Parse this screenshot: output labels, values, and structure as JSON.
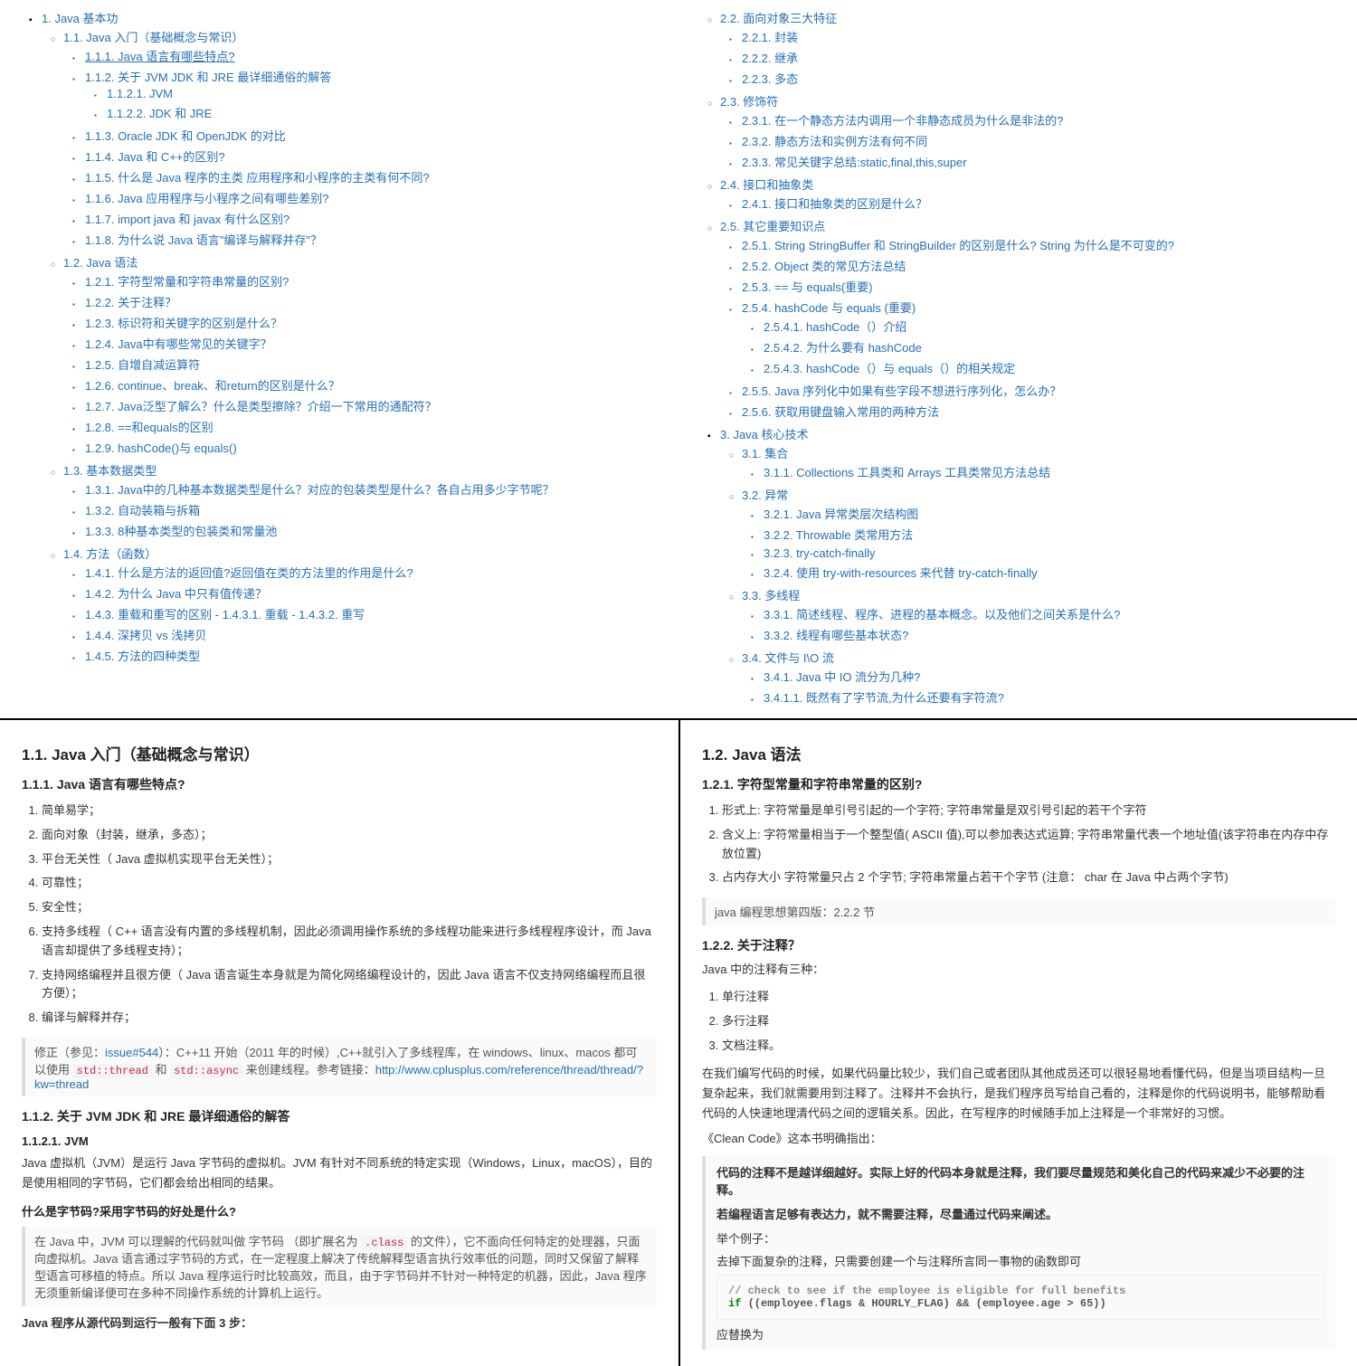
{
  "tocLeft": [
    {
      "t": "disc",
      "label": "1. Java 基本功",
      "children": [
        {
          "t": "circ",
          "label": "1.1. Java 入门（基础概念与常识）",
          "children": [
            {
              "t": "sq",
              "label": "1.1.1. Java 语言有哪些特点?",
              "underline": true
            },
            {
              "t": "sq",
              "label": "1.1.2. 关于 JVM JDK 和 JRE 最详细通俗的解答",
              "children": [
                {
                  "t": "sq",
                  "label": "1.1.2.1. JVM"
                },
                {
                  "t": "sq",
                  "label": "1.1.2.2. JDK 和 JRE"
                }
              ]
            },
            {
              "t": "sq",
              "label": "1.1.3. Oracle JDK 和 OpenJDK 的对比"
            },
            {
              "t": "sq",
              "label": "1.1.4. Java 和 C++的区别?"
            },
            {
              "t": "sq",
              "label": "1.1.5. 什么是 Java 程序的主类 应用程序和小程序的主类有何不同?"
            },
            {
              "t": "sq",
              "label": "1.1.6. Java 应用程序与小程序之间有哪些差别?"
            },
            {
              "t": "sq",
              "label": "1.1.7. import java 和 javax 有什么区别?"
            },
            {
              "t": "sq",
              "label": "1.1.8. 为什么说 Java 语言\"编译与解释并存\"？"
            }
          ]
        },
        {
          "t": "circ",
          "label": "1.2. Java 语法",
          "children": [
            {
              "t": "sq",
              "label": "1.2.1. 字符型常量和字符串常量的区别?"
            },
            {
              "t": "sq",
              "label": "1.2.2. 关于注释？"
            },
            {
              "t": "sq",
              "label": "1.2.3. 标识符和关键字的区别是什么？"
            },
            {
              "t": "sq",
              "label": "1.2.4. Java中有哪些常见的关键字？"
            },
            {
              "t": "sq",
              "label": "1.2.5. 自增自减运算符"
            },
            {
              "t": "sq",
              "label": "1.2.6. continue、break、和return的区别是什么？"
            },
            {
              "t": "sq",
              "label": "1.2.7. Java泛型了解么？什么是类型擦除？介绍一下常用的通配符？"
            },
            {
              "t": "sq",
              "label": "1.2.8. ==和equals的区别"
            },
            {
              "t": "sq",
              "label": "1.2.9. hashCode()与 equals()"
            }
          ]
        },
        {
          "t": "circ",
          "label": "1.3. 基本数据类型",
          "children": [
            {
              "t": "sq",
              "label": "1.3.1. Java中的几种基本数据类型是什么？对应的包装类型是什么？各自占用多少字节呢？"
            },
            {
              "t": "sq",
              "label": "1.3.2. 自动装箱与拆箱"
            },
            {
              "t": "sq",
              "label": "1.3.3. 8种基本类型的包装类和常量池"
            }
          ]
        },
        {
          "t": "circ",
          "label": "1.4. 方法（函数）",
          "children": [
            {
              "t": "sq",
              "label": "1.4.1. 什么是方法的返回值?返回值在类的方法里的作用是什么?"
            },
            {
              "t": "sq",
              "label": "1.4.2. 为什么 Java 中只有值传递？"
            },
            {
              "t": "sq",
              "label": "1.4.3. 重载和重写的区别 - 1.4.3.1. 重载 - 1.4.3.2. 重写"
            },
            {
              "t": "sq",
              "label": "1.4.4. 深拷贝 vs 浅拷贝"
            },
            {
              "t": "sq",
              "label": "1.4.5. 方法的四种类型"
            }
          ]
        }
      ]
    }
  ],
  "tocRight": [
    {
      "t": "circ",
      "label": "2.2. 面向对象三大特征",
      "children": [
        {
          "t": "sq",
          "label": "2.2.1. 封装"
        },
        {
          "t": "sq",
          "label": "2.2.2. 继承"
        },
        {
          "t": "sq",
          "label": "2.2.3. 多态"
        }
      ]
    },
    {
      "t": "circ",
      "label": "2.3. 修饰符",
      "children": [
        {
          "t": "sq",
          "label": "2.3.1. 在一个静态方法内调用一个非静态成员为什么是非法的?"
        },
        {
          "t": "sq",
          "label": "2.3.2. 静态方法和实例方法有何不同"
        },
        {
          "t": "sq",
          "label": "2.3.3. 常见关键字总结:static,final,this,super"
        }
      ]
    },
    {
      "t": "circ",
      "label": "2.4. 接口和抽象类",
      "children": [
        {
          "t": "sq",
          "label": "2.4.1. 接口和抽象类的区别是什么？"
        }
      ]
    },
    {
      "t": "circ",
      "label": "2.5. 其它重要知识点",
      "children": [
        {
          "t": "sq",
          "label": "2.5.1. String StringBuffer 和 StringBuilder 的区别是什么? String 为什么是不可变的?"
        },
        {
          "t": "sq",
          "label": "2.5.2. Object 类的常见方法总结"
        },
        {
          "t": "sq",
          "label": "2.5.3. == 与 equals(重要)"
        },
        {
          "t": "sq",
          "label": "2.5.4. hashCode 与 equals (重要)",
          "children": [
            {
              "t": "sq",
              "label": "2.5.4.1. hashCode（）介绍"
            },
            {
              "t": "sq",
              "label": "2.5.4.2. 为什么要有 hashCode"
            },
            {
              "t": "sq",
              "label": "2.5.4.3. hashCode（）与 equals（）的相关规定"
            }
          ]
        },
        {
          "t": "sq",
          "label": "2.5.5. Java 序列化中如果有些字段不想进行序列化，怎么办？"
        },
        {
          "t": "sq",
          "label": "2.5.6. 获取用键盘输入常用的两种方法"
        }
      ]
    },
    {
      "t": "disc",
      "label": "3. Java 核心技术",
      "children": [
        {
          "t": "circ",
          "label": "3.1. 集合",
          "children": [
            {
              "t": "sq",
              "label": "3.1.1. Collections 工具类和 Arrays 工具类常见方法总结"
            }
          ]
        },
        {
          "t": "circ",
          "label": "3.2. 异常",
          "children": [
            {
              "t": "sq",
              "label": "3.2.1. Java 异常类层次结构图"
            },
            {
              "t": "sq",
              "label": "3.2.2. Throwable 类常用方法"
            },
            {
              "t": "sq",
              "label": "3.2.3. try-catch-finally"
            },
            {
              "t": "sq",
              "label": "3.2.4. 使用 try-with-resources 来代替 try-catch-finally",
              "code": true
            }
          ]
        },
        {
          "t": "circ",
          "label": "3.3. 多线程",
          "children": [
            {
              "t": "sq",
              "label": "3.3.1. 简述线程、程序、进程的基本概念。以及他们之间关系是什么?"
            },
            {
              "t": "sq",
              "label": "3.3.2. 线程有哪些基本状态?"
            }
          ]
        },
        {
          "t": "circ",
          "label": "3.4. 文件与 I\\O 流",
          "children": [
            {
              "t": "sq",
              "label": "3.4.1. Java 中 IO 流分为几种?"
            },
            {
              "t": "sq",
              "label": "3.4.1.1. 既然有了字节流,为什么还要有字符流?"
            }
          ]
        }
      ]
    }
  ],
  "leftContent": {
    "h11": "1.1. Java 入门（基础概念与常识）",
    "h111": "1.1.1. Java 语言有哪些特点?",
    "features": [
      "简单易学；",
      "面向对象（封装，继承，多态）；",
      "平台无关性（ Java 虚拟机实现平台无关性）；",
      "可靠性；",
      "安全性；",
      "支持多线程（ C++ 语言没有内置的多线程机制，因此必须调用操作系统的多线程功能来进行多线程程序设计，而 Java 语言却提供了多线程支持）；",
      "支持网络编程并且很方便（ Java 语言诞生本身就是为简化网络编程设计的，因此 Java 语言不仅支持网络编程而且很方便）；",
      "编译与解释并存；"
    ],
    "fixPrefix": "修正（参见：",
    "issueLink": "issue#544",
    "fixBody": "）：C++11 开始（2011 年的时候）,C++就引入了多线程库，在 windows、linux、macos 都可以使用 ",
    "stdThread": "std::thread",
    "and": " 和 ",
    "stdAsync": "std::async",
    "fixTail": " 来创建线程。参考链接：",
    "refUrl": "http://www.cplusplus.com/reference/thread/thread/?kw=thread",
    "h112": "1.1.2. 关于 JVM JDK 和 JRE 最详细通俗的解答",
    "h1121": "1.1.2.1. JVM",
    "jvmPara": "Java 虚拟机（JVM）是运行 Java 字节码的虚拟机。JVM 有针对不同系统的特定实现（Windows，Linux，macOS），目的是使用相同的字节码，它们都会给出相同的结果。",
    "bytecodeQ": "什么是字节码?采用字节码的好处是什么?",
    "bytecodeQuotePrefix": "在 Java 中，JVM 可以理解的代码就叫做 字节码 （即扩展名为 ",
    "classExt": ".class",
    "bytecodeQuoteTail": " 的文件），它不面向任何特定的处理器，只面向虚拟机。Java 语言通过字节码的方式，在一定程度上解决了传统解释型语言执行效率低的问题，同时又保留了解释型语言可移植的特点。所以 Java 程序运行时比较高效，而且，由于字节码并不针对一种特定的机器，因此，Java 程序无须重新编译便可在多种不同操作系统的计算机上运行。",
    "stepsTitle": "Java 程序从源代码到运行一般有下面 3 步："
  },
  "rightContent": {
    "h12": "1.2. Java 语法",
    "h121": "1.2.1. 字符型常量和字符串常量的区别?",
    "charDiff": [
      "形式上: 字符常量是单引号引起的一个字符; 字符串常量是双引号引起的若干个字符",
      "含义上: 字符常量相当于一个整型值( ASCII 值),可以参加表达式运算; 字符串常量代表一个地址值(该字符串在内存中存放位置)",
      "占内存大小 字符常量只占 2 个字节; 字符串常量占若干个字节 (注意： char 在 Java 中占两个字节)"
    ],
    "charRef": "java 编程思想第四版：2.2.2 节",
    "h122": "1.2.2. 关于注释？",
    "commentIntro": "Java 中的注释有三种：",
    "commentTypes": [
      "单行注释",
      "多行注释",
      "文档注释。"
    ],
    "commentPara": "在我们编写代码的时候，如果代码量比较少，我们自己或者团队其他成员还可以很轻易地看懂代码，但是当项目结构一旦复杂起来，我们就需要用到注释了。注释并不会执行，是我们程序员写给自己看的，注释是你的代码说明书，能够帮助看代码的人快速地理清代码之间的逻辑关系。因此，在写程序的时候随手加上注释是一个非常好的习惯。",
    "cleanCode": "《Clean Code》这本书明确指出：",
    "quoteMain": "代码的注释不是越详细越好。实际上好的代码本身就是注释，我们要尽量规范和美化自己的代码来减少不必要的注释。",
    "quoteSub": "若编程语言足够有表达力，就不需要注释，尽量通过代码来阐述。",
    "example": "举个例子：",
    "deleteNote": "去掉下面复杂的注释，只需要创建一个与注释所言同一事物的函数即可",
    "codeComment": "// check to see if the employee is eligible for full benefits",
    "codeLine": "if ((employee.flags & HOURLY_FLAG) && (employee.age > 65))",
    "shouldChange": "应替换为"
  }
}
